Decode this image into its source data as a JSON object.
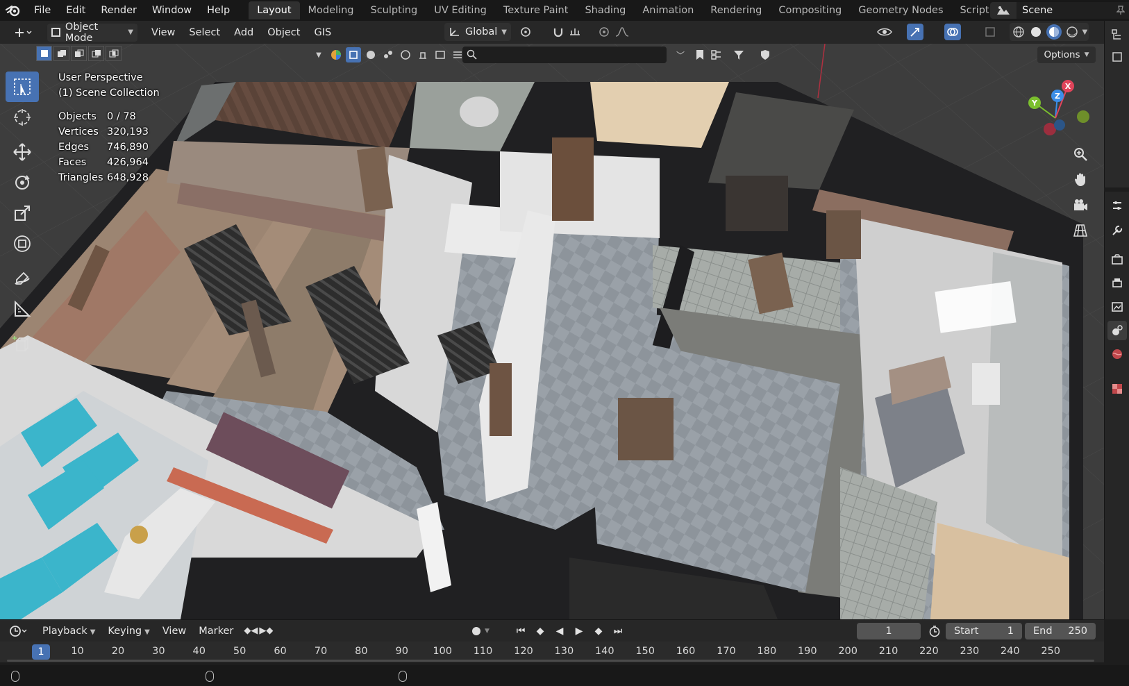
{
  "app": {
    "menu": [
      "File",
      "Edit",
      "Render",
      "Window",
      "Help"
    ],
    "workspaces": [
      "Layout",
      "Modeling",
      "Sculpting",
      "UV Editing",
      "Texture Paint",
      "Shading",
      "Animation",
      "Rendering",
      "Compositing",
      "Geometry Nodes",
      "Scripting"
    ],
    "active_workspace": "Layout",
    "scene_name": "Scene"
  },
  "viewport_header": {
    "mode": "Object Mode",
    "menus": [
      "View",
      "Select",
      "Add",
      "Object",
      "GIS"
    ],
    "orientation": "Global",
    "options_label": "Options"
  },
  "overlay_info": {
    "perspective": "User Perspective",
    "collection": "(1) Scene Collection",
    "stats": [
      {
        "label": "Objects",
        "value": "0 / 78"
      },
      {
        "label": "Vertices",
        "value": "320,193"
      },
      {
        "label": "Edges",
        "value": "746,890"
      },
      {
        "label": "Faces",
        "value": "426,964"
      },
      {
        "label": "Triangles",
        "value": "648,928"
      }
    ]
  },
  "gizmo": {
    "x_label": "X",
    "y_label": "Y",
    "z_label": "Z",
    "x_color": "#e0445a",
    "y_color": "#7bbf2e",
    "z_color": "#3b8ee8"
  },
  "timeline": {
    "menus": [
      "Playback",
      "Keying",
      "View",
      "Marker"
    ],
    "current_frame": "1",
    "start_label": "Start",
    "start_value": "1",
    "end_label": "End",
    "end_value": "250",
    "ruler_current": "1",
    "ruler_ticks": [
      "10",
      "20",
      "30",
      "40",
      "50",
      "60",
      "70",
      "80",
      "90",
      "100",
      "110",
      "120",
      "130",
      "140",
      "150",
      "160",
      "170",
      "180",
      "190",
      "200",
      "210",
      "220",
      "230",
      "240",
      "250"
    ]
  },
  "colors": {
    "accent": "#4772b3",
    "background": "#1d1d1d",
    "header": "#272727"
  }
}
